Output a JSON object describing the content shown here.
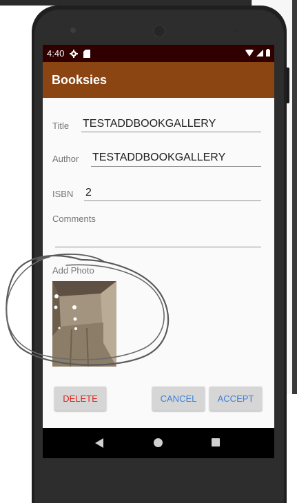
{
  "status_bar": {
    "time": "4:40"
  },
  "app_bar": {
    "title": "Booksies"
  },
  "form": {
    "title_label": "Title",
    "title_value": "TESTADDBOOKGALLERY",
    "author_label": "Author",
    "author_value": "TESTADDBOOKGALLERY",
    "isbn_label": "ISBN",
    "isbn_value": "2",
    "comments_label": "Comments",
    "comments_value": "",
    "add_photo_label": "Add Photo"
  },
  "buttons": {
    "delete": "DELETE",
    "cancel": "CANCEL",
    "accept": "ACCEPT"
  },
  "colors": {
    "app_bar": "#8b4513",
    "status_bar": "#300000",
    "delete_text": "#e0201c",
    "action_text": "#3c7fd8"
  }
}
